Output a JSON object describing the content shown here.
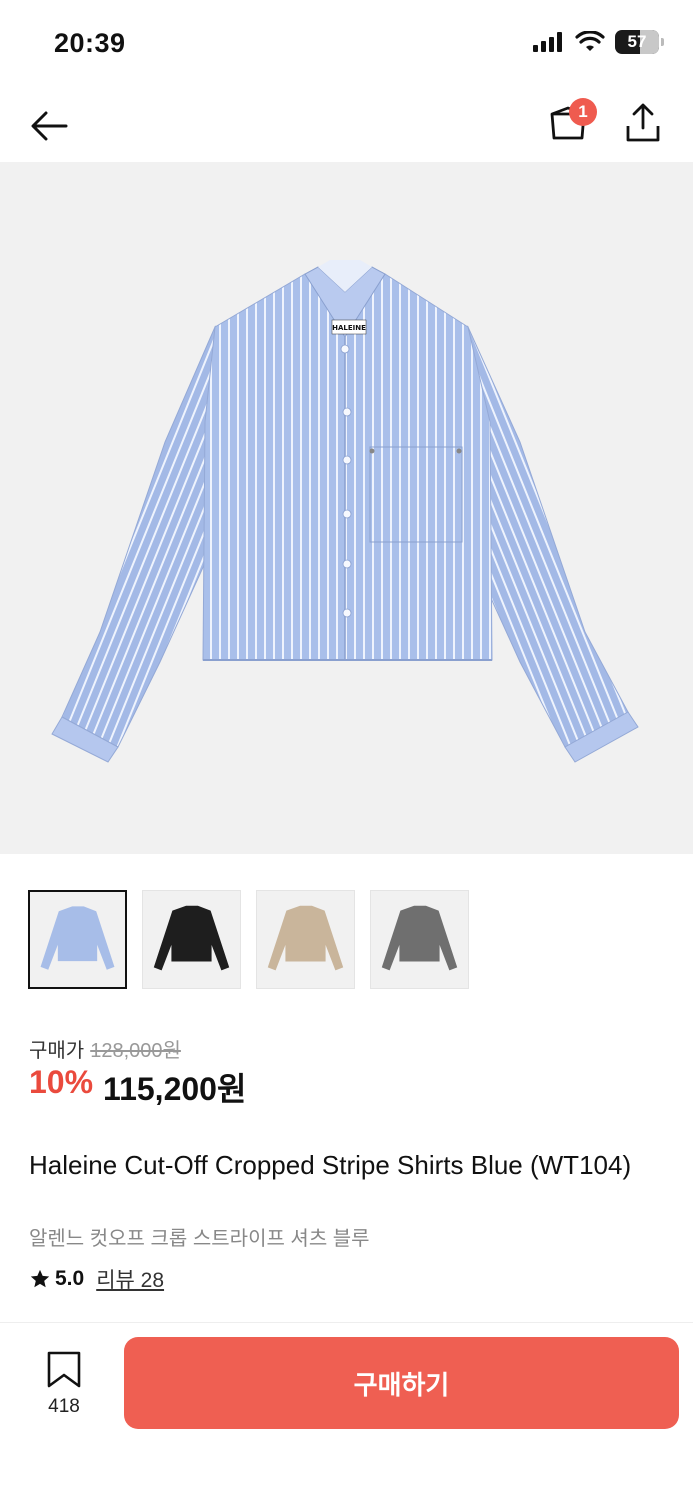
{
  "status": {
    "time": "20:39",
    "battery": "57"
  },
  "nav": {
    "cart_count": "1"
  },
  "thumbnails": [
    {
      "color": "#a7bde8",
      "alt": "blue"
    },
    {
      "color": "#1e1e1e",
      "alt": "black"
    },
    {
      "color": "#c9b59b",
      "alt": "beige"
    },
    {
      "color": "#6f6f6f",
      "alt": "gray"
    }
  ],
  "price": {
    "label": "구매가",
    "original": "128,000원",
    "discount": "10%",
    "sale": "115,200원"
  },
  "product": {
    "name": "Haleine Cut-Off Cropped Stripe Shirts Blue (WT104)",
    "name_ko": "알렌느 컷오프 크롭 스트라이프 셔츠 블루",
    "brand_label": "HALEINE",
    "rating": "5.0",
    "review_text": "리뷰 28"
  },
  "bottom": {
    "bookmark_count": "418",
    "buy_label": "구매하기"
  },
  "colors": {
    "accent": "#ef5f52",
    "discount": "#ea4a3d",
    "badge": "#ef5b4f"
  }
}
